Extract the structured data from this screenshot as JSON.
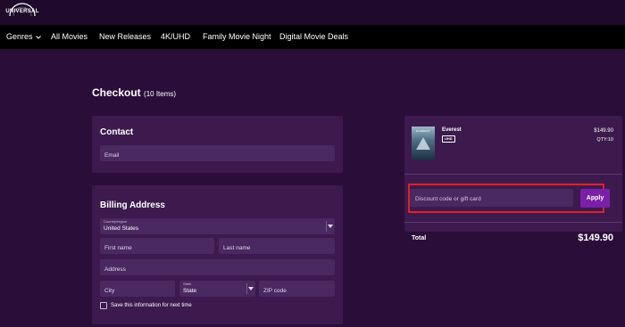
{
  "brand": {
    "logo_text": "UNIVERSAL"
  },
  "nav": {
    "items": [
      {
        "label": "Genres",
        "has_dropdown": true
      },
      {
        "label": "All Movies"
      },
      {
        "label": "New Releases"
      },
      {
        "label": "4K/UHD"
      },
      {
        "label": "Family Movie Night"
      },
      {
        "label": "Digital Movie Deals"
      }
    ]
  },
  "checkout": {
    "title": "Checkout",
    "count": "(10 Items)"
  },
  "contact": {
    "title": "Contact",
    "email_placeholder": "Email"
  },
  "billing": {
    "title": "Billing Address",
    "country_label": "Country/region",
    "country_value": "United States",
    "first_name_placeholder": "First name",
    "last_name_placeholder": "Last name",
    "address_placeholder": "Address",
    "city_placeholder": "City",
    "state_label": "State",
    "state_value": "State",
    "zip_placeholder": "ZIP code",
    "save_info_label": "Save this information for next time"
  },
  "summary": {
    "product": {
      "name": "Everest",
      "format_badge": "UHD",
      "poster_title": "EVEREST",
      "price": "$149.90",
      "qty": "QTY:10"
    },
    "discount_placeholder": "Discount code or gift card",
    "apply_label": "Apply",
    "total_label": "Total",
    "total_value": "$149.90"
  },
  "colors": {
    "background": "#2b0d3a",
    "card": "#3c1a4d",
    "field": "#4a2860",
    "nav": "#000000",
    "accent": "#7b1fa8",
    "highlight": "#e0202a"
  }
}
